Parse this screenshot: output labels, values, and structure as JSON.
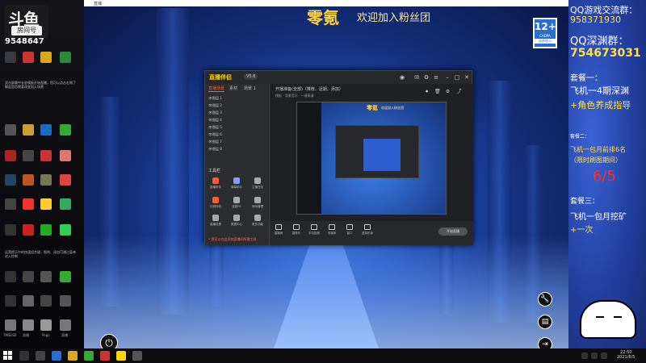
{
  "left_desktop": {
    "logo_main": "斗鱼",
    "logo_sub": "房间号",
    "room_number": "9548647",
    "note_top": "双击屏幕中长驻模板开始直播，您可以点击右侧了解此是否需要改变加入场景",
    "note_bottom": "运营提示中的快速组合键，图例、添加可通过菜单进入控制",
    "labels": [
      "TMSESR",
      "直播",
      "Pogo",
      "直播"
    ]
  },
  "browser_tab": {
    "title": "直播"
  },
  "stage": {
    "title": "零氪",
    "subtitle": "欢迎加入粉丝团",
    "age_badge": {
      "number": "12+",
      "cadpa": "CADPA",
      "text": "适龄提示"
    }
  },
  "app": {
    "logo": "直播伴侣",
    "version": "V5.6",
    "sidebar_tabs": [
      "直播场景",
      "素材",
      "场景 1"
    ],
    "scenes": [
      "图层 1",
      "图层 2",
      "图层 3",
      "图层 4",
      "图层 5",
      "图层 6",
      "图层 7",
      "图层 8"
    ],
    "tools_title": "工具栏",
    "tools": [
      {
        "label": "直播助手",
        "color": "#ff5c2a"
      },
      {
        "label": "弹幕助手",
        "color": "#8899ff"
      },
      {
        "label": "主播任务",
        "color": "#aaaaaa"
      },
      {
        "label": "礼物特效",
        "color": "#ff5c2a"
      },
      {
        "label": "连麦PK",
        "color": "#aaaaaa"
      },
      {
        "label": "房间管理",
        "color": "#aaaaaa"
      },
      {
        "label": "直播设置",
        "color": "#aaaaaa"
      },
      {
        "label": "数据中心",
        "color": "#aaaaaa"
      },
      {
        "label": "更多功能",
        "color": "#aaaaaa"
      }
    ],
    "hint": "• 您可以在此添加直播间所需工具",
    "main_title": "开播准备(全部)（推荐、近期、添加）",
    "main_sub": "模板 · 背景音乐 · 一键高清",
    "preview_title": "零氪",
    "preview_sub": "欢迎加入粉丝团",
    "bottom_buttons": [
      "直播间",
      "摄像头",
      "手机投屏",
      "多媒体",
      "窗口",
      "虚拟形象"
    ],
    "start_live": "开始直播"
  },
  "right_panel": {
    "qq_group_label": "QQ游戏交流群：",
    "qq_group_number": "958371930",
    "qq_abyss_label": "QQ深渊群：",
    "qq_abyss_number": "754673031",
    "package1_title": "套餐一：",
    "package1_line1": "飞机一4期深渊",
    "package1_line2": "+角色养成指导",
    "package2_title": "套餐二：",
    "package2_line1": "飞机一包月前排6名",
    "package2_line2": "（限时刷图期间）",
    "date": "6/5",
    "package3_title": "套餐三：",
    "package3_line1": "飞机一包月挖矿",
    "package3_line2": "+一次"
  },
  "taskbar": {
    "time": "22:50",
    "date": "2021/6/5"
  }
}
